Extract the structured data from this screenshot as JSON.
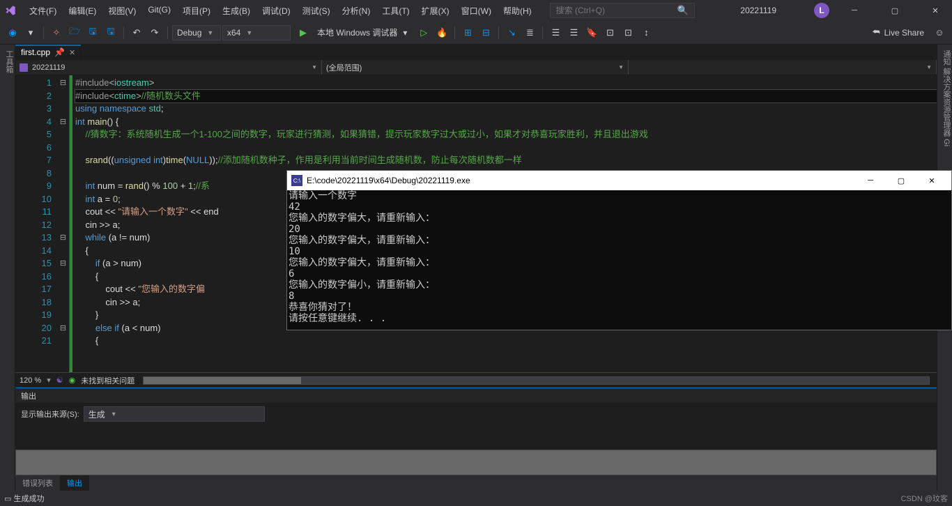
{
  "menu": [
    "文件(F)",
    "编辑(E)",
    "视图(V)",
    "Git(G)",
    "项目(P)",
    "生成(B)",
    "调试(D)",
    "测试(S)",
    "分析(N)",
    "工具(T)",
    "扩展(X)",
    "窗口(W)",
    "帮助(H)"
  ],
  "search_placeholder": "搜索 (Ctrl+Q)",
  "project_name": "20221119",
  "avatar_letter": "L",
  "toolbar": {
    "config": "Debug",
    "platform": "x64",
    "run_label": "本地 Windows 调试器",
    "liveshare": "Live Share"
  },
  "left_rail": "工具箱",
  "right_rail": "通知  解决方案资源管理器  Gi",
  "tab_name": "first.cpp",
  "nav_scope": "20221119",
  "nav_scope2": "(全局范围)",
  "code_lines": [
    {
      "n": 1,
      "fold": "⊟",
      "html": "<span class='pp'>#include</span><span class='op'>&lt;</span><span class='ty'>iostream</span><span class='op'>&gt;</span>"
    },
    {
      "n": 2,
      "fold": "",
      "hl": true,
      "html": "<span class='pp'>#include</span><span class='op'>&lt;</span><span class='ty'>ctime</span><span class='op'>&gt;</span><span class='cm'>//随机数头文件</span>"
    },
    {
      "n": 3,
      "fold": "",
      "html": "<span class='kw'>using</span> <span class='kw'>namespace</span> <span class='ty'>std</span>;"
    },
    {
      "n": 4,
      "fold": "⊟",
      "html": "<span class='kw'>int</span> <span class='fn'>main</span>() {"
    },
    {
      "n": 5,
      "fold": "",
      "html": "    <span class='cm'>//猜数字：系统随机生成一个1-100之间的数字，玩家进行猜测，如果猜错，提示玩家数字过大或过小，如果才对恭喜玩家胜利，并且退出游戏</span>"
    },
    {
      "n": 6,
      "fold": "",
      "html": ""
    },
    {
      "n": 7,
      "fold": "",
      "html": "    <span class='fn'>srand</span>((<span class='kw'>unsigned</span> <span class='kw'>int</span>)<span class='fn'>time</span>(<span class='kw'>NULL</span>));<span class='cm'>//添加随机数种子，作用是利用当前时间生成随机数，防止每次随机数都一样</span>"
    },
    {
      "n": 8,
      "fold": "",
      "html": ""
    },
    {
      "n": 9,
      "fold": "",
      "html": "    <span class='kw'>int</span> num = <span class='fn'>rand</span>() % <span class='num'>100</span> + <span class='num'>1</span>;<span class='cm'>//系</span>"
    },
    {
      "n": 10,
      "fold": "",
      "html": "    <span class='kw'>int</span> a = <span class='num'>0</span>;"
    },
    {
      "n": 11,
      "fold": "",
      "html": "    cout &lt;&lt; <span class='str'>\"请输入一个数字\"</span> &lt;&lt; end"
    },
    {
      "n": 12,
      "fold": "",
      "html": "    cin &gt;&gt; a;"
    },
    {
      "n": 13,
      "fold": "⊟",
      "html": "    <span class='kw'>while</span> (a != num)"
    },
    {
      "n": 14,
      "fold": "",
      "html": "    {"
    },
    {
      "n": 15,
      "fold": "⊟",
      "html": "        <span class='kw'>if</span> (a &gt; num)"
    },
    {
      "n": 16,
      "fold": "",
      "html": "        {"
    },
    {
      "n": 17,
      "fold": "",
      "html": "            cout &lt;&lt; <span class='str'>\"您输入的数字偏</span>"
    },
    {
      "n": 18,
      "fold": "",
      "html": "            cin &gt;&gt; a;"
    },
    {
      "n": 19,
      "fold": "",
      "html": "        }"
    },
    {
      "n": 20,
      "fold": "⊟",
      "html": "        <span class='kw'>else</span> <span class='kw'>if</span> (a &lt; num)"
    },
    {
      "n": 21,
      "fold": "",
      "html": "        {"
    }
  ],
  "editor_footer": {
    "zoom": "120 %",
    "status": "未找到相关问题"
  },
  "output": {
    "title": "输出",
    "src_label": "显示输出来源(S):",
    "src_value": "生成",
    "tabs": [
      "错误列表",
      "输出"
    ]
  },
  "status_text": "生成成功",
  "watermark": "CSDN @玟客",
  "console": {
    "title": "E:\\code\\20221119\\x64\\Debug\\20221119.exe",
    "lines": [
      "请输入一个数字",
      "42",
      "您输入的数字偏大，请重新输入：",
      "20",
      "您输入的数字偏大，请重新输入：",
      "10",
      "您输入的数字偏大，请重新输入：",
      "6",
      "您输入的数字偏小，请重新输入：",
      "8",
      "恭喜你猜对了！",
      "请按任意键继续. . ."
    ]
  }
}
